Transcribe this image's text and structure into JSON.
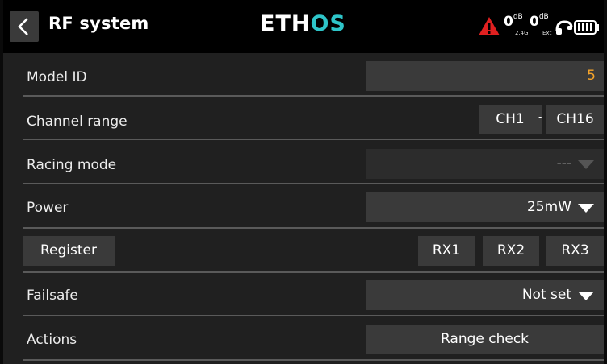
{
  "header": {
    "title": "RF system",
    "logo": {
      "part1": "ETH",
      "part2": "OS"
    },
    "signal_int": {
      "value": "0",
      "unit": "dB",
      "band": "2.4G"
    },
    "signal_ext": {
      "value": "0",
      "unit": "dB",
      "band": "Ext"
    },
    "icons": {
      "back": "chevron-left-icon",
      "warning": "warning-triangle-icon",
      "phone": "headphone-icon",
      "battery": "battery-icon"
    },
    "colors": {
      "logo_accent": "#2ec5c9",
      "warning": "#e02020",
      "value_accent": "#f4a32a"
    }
  },
  "rows": {
    "model_id": {
      "label": "Model ID",
      "value": "5"
    },
    "channel_range": {
      "label": "Channel range",
      "start": "CH1",
      "separator": "-",
      "end": "CH16"
    },
    "racing_mode": {
      "label": "Racing mode",
      "value": "---",
      "disabled": true
    },
    "power": {
      "label": "Power",
      "value": "25mW"
    },
    "register": {
      "button": "Register",
      "rx": [
        "RX1",
        "RX2",
        "RX3"
      ]
    },
    "failsafe": {
      "label": "Failsafe",
      "value": "Not set"
    },
    "actions": {
      "label": "Actions",
      "button": "Range check"
    }
  }
}
